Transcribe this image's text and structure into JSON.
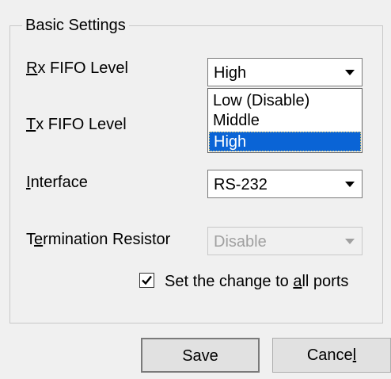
{
  "group": {
    "title": "Basic Settings"
  },
  "rx_fifo": {
    "label_mnemonic": "R",
    "label_rest": "x FIFO Level",
    "value": "High",
    "options": [
      "Low (Disable)",
      "Middle",
      "High"
    ]
  },
  "tx_fifo": {
    "label_mnemonic": "T",
    "label_rest": "x FIFO Level"
  },
  "interface": {
    "label_mnemonic": "I",
    "label_rest": "nterface",
    "value": "RS-232"
  },
  "termination": {
    "label_pre": "T",
    "label_mnemonic": "e",
    "label_rest": "rmination Resistor",
    "value": "Disable"
  },
  "apply_all": {
    "label_pre": "Set the change to ",
    "label_mnemonic": "a",
    "label_rest": "ll ports",
    "checked": true
  },
  "buttons": {
    "save_label": "Save",
    "cancel_pre": "Cance",
    "cancel_mnemonic": "l"
  },
  "icons": {
    "dropdown_arrow": "chevron-down-icon",
    "checkmark": "check-icon"
  }
}
